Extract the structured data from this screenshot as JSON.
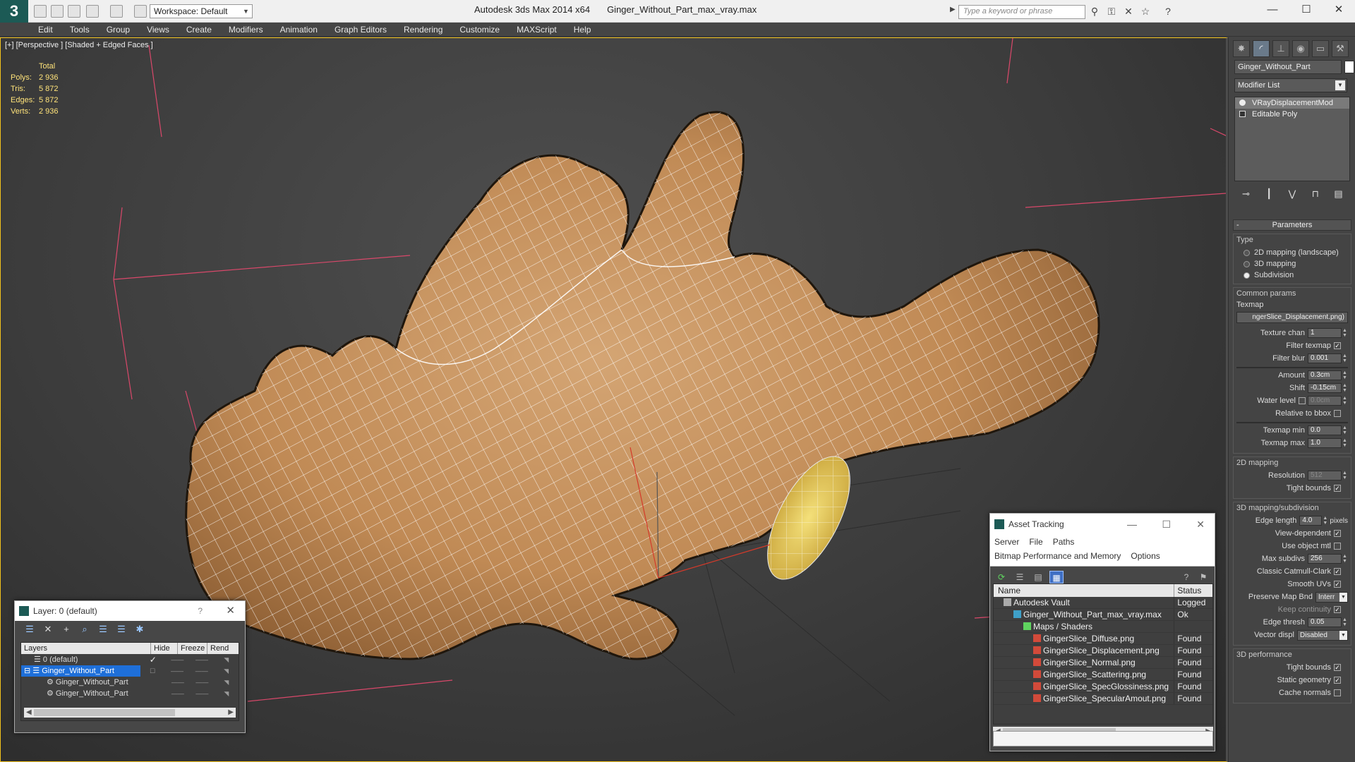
{
  "titlebar": {
    "workspace_label": "Workspace: Default",
    "app_name": "Autodesk 3ds Max  2014 x64",
    "file_name": "Ginger_Without_Part_max_vray.max",
    "search_placeholder": "Type a keyword or phrase"
  },
  "menu": [
    "Edit",
    "Tools",
    "Group",
    "Views",
    "Create",
    "Modifiers",
    "Animation",
    "Graph Editors",
    "Rendering",
    "Customize",
    "MAXScript",
    "Help"
  ],
  "viewport": {
    "label": "[+] [Perspective ] [Shaded + Edged Faces ]",
    "stats": {
      "header": "Total",
      "rows": [
        {
          "k": "Polys:",
          "v": "2 936"
        },
        {
          "k": "Tris:",
          "v": "5 872"
        },
        {
          "k": "Edges:",
          "v": "5 872"
        },
        {
          "k": "Verts:",
          "v": "2 936"
        }
      ]
    }
  },
  "command_panel": {
    "object_name": "Ginger_Without_Part",
    "modifier_list": "Modifier List",
    "stack": [
      "VRayDisplacementMod",
      "Editable Poly"
    ],
    "rollout_title": "Parameters",
    "type_group": {
      "title": "Type",
      "options": [
        "2D mapping (landscape)",
        "3D mapping",
        "Subdivision"
      ],
      "selected": "Subdivision"
    },
    "common_title": "Common params",
    "texmap_label": "Texmap",
    "texmap_value": "ngerSlice_Displacement.png)",
    "texture_chan_label": "Texture chan",
    "texture_chan": "1",
    "filter_texmap_label": "Filter texmap",
    "filter_blur_label": "Filter blur",
    "filter_blur": "0.001",
    "amount_label": "Amount",
    "amount": "0.3cm",
    "shift_label": "Shift",
    "shift": "-0.15cm",
    "water_level_label": "Water level",
    "water_level": "0.0cm",
    "relative_bbox_label": "Relative to bbox",
    "texmap_min_label": "Texmap min",
    "texmap_min": "0.0",
    "texmap_max_label": "Texmap max",
    "texmap_max": "1.0",
    "mapping2d_title": "2D mapping",
    "resolution_label": "Resolution",
    "resolution": "512",
    "tight_bounds_label": "Tight bounds",
    "sub3d_title": "3D mapping/subdivision",
    "edge_length_label": "Edge length",
    "edge_length": "4.0",
    "edge_unit": "pixels",
    "view_dependent_label": "View-dependent",
    "use_object_mtl_label": "Use object mtl",
    "max_subdivs_label": "Max subdivs",
    "max_subdivs": "256",
    "catmull_label": "Classic Catmull-Clark",
    "smooth_uvs_label": "Smooth UVs",
    "preserve_map_label": "Preserve Map Bnd",
    "preserve_map": "Interr",
    "keep_continuity_label": "Keep continuity",
    "edge_thresh_label": "Edge thresh",
    "edge_thresh": "0.05",
    "vector_displ_label": "Vector displ",
    "vector_displ": "Disabled",
    "perf_title": "3D performance",
    "perf_tight_label": "Tight bounds",
    "static_geo_label": "Static geometry",
    "cache_normals_label": "Cache normals"
  },
  "layer_window": {
    "title": "Layer: 0 (default)",
    "help": "?",
    "columns": [
      "Layers",
      "Hide",
      "Freeze",
      "Rend"
    ],
    "rows": [
      {
        "name": "0 (default)",
        "indent": 1
      },
      {
        "name": "Ginger_Without_Part",
        "indent": 1
      },
      {
        "name": "Ginger_Without_Part",
        "indent": 2
      },
      {
        "name": "Ginger_Without_Part",
        "indent": 2
      }
    ]
  },
  "asset_window": {
    "title": "Asset Tracking",
    "menu_row1": [
      "Server",
      "File",
      "Paths"
    ],
    "menu_row2": [
      "Bitmap Performance and Memory",
      "Options"
    ],
    "columns": [
      "Name",
      "Status"
    ],
    "rows": [
      {
        "name": "Autodesk Vault",
        "status": "Logged",
        "indent": 1,
        "icon": "vault"
      },
      {
        "name": "Ginger_Without_Part_max_vray.max",
        "status": "Ok",
        "indent": 2,
        "icon": "max"
      },
      {
        "name": "Maps / Shaders",
        "status": "",
        "indent": 3,
        "icon": "maps"
      },
      {
        "name": "GingerSlice_Diffuse.png",
        "status": "Found",
        "indent": 4,
        "icon": "png"
      },
      {
        "name": "GingerSlice_Displacement.png",
        "status": "Found",
        "indent": 4,
        "icon": "png"
      },
      {
        "name": "GingerSlice_Normal.png",
        "status": "Found",
        "indent": 4,
        "icon": "png"
      },
      {
        "name": "GingerSlice_Scattering.png",
        "status": "Found",
        "indent": 4,
        "icon": "png"
      },
      {
        "name": "GingerSlice_SpecGlossiness.png",
        "status": "Found",
        "indent": 4,
        "icon": "png"
      },
      {
        "name": "GingerSlice_SpecularAmout.png",
        "status": "Found",
        "indent": 4,
        "icon": "png"
      }
    ]
  },
  "colors": {
    "accent": "#f2c21c",
    "selection": "#1e6fd9",
    "mesh_fill": "#c8935e",
    "wire": "#ffffff",
    "grid_red": "#d9486a"
  }
}
